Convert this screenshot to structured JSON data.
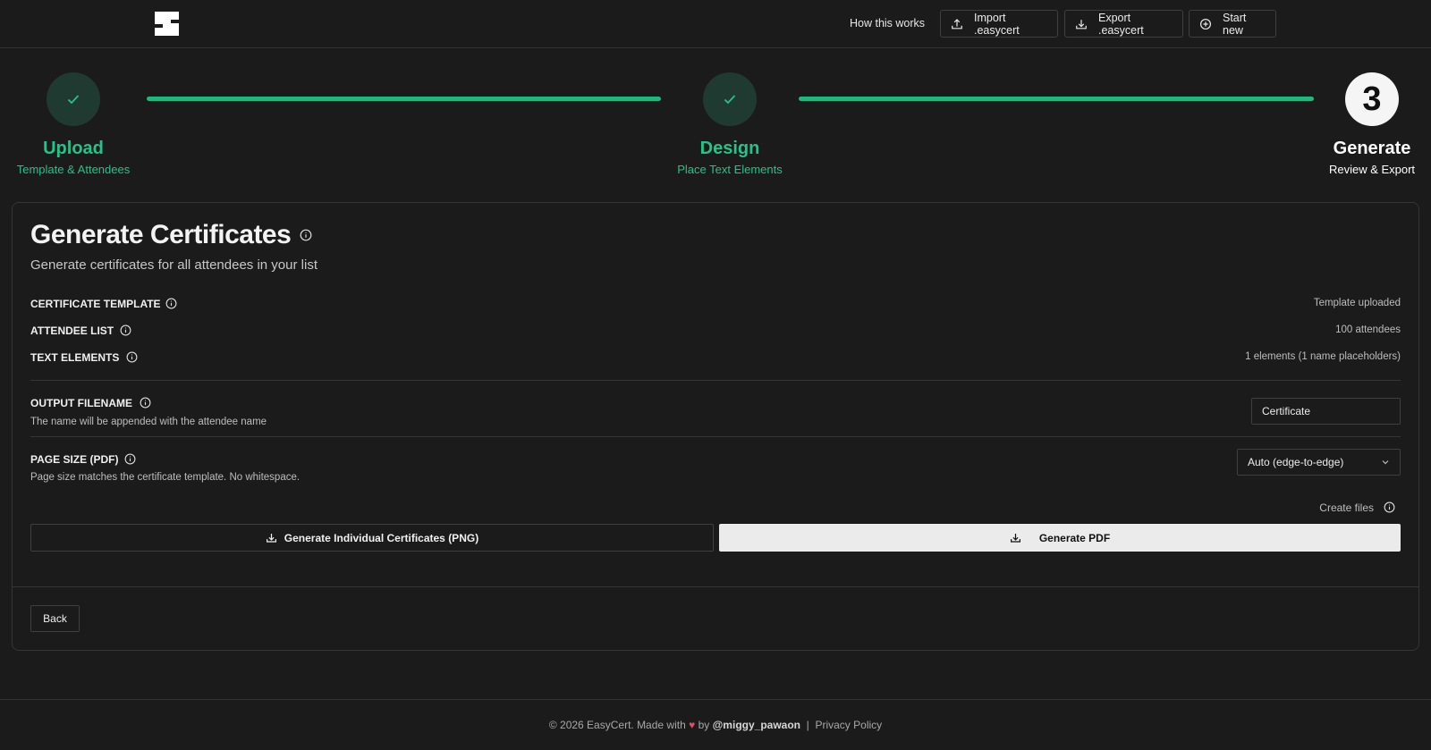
{
  "header": {
    "how_it_works": "How this works",
    "import_label": "Import .easycert",
    "export_label": "Export .easycert",
    "start_new_label": "Start new"
  },
  "stepper": {
    "steps": [
      {
        "title": "Upload",
        "subtitle": "Template & Attendees",
        "state": "done"
      },
      {
        "title": "Design",
        "subtitle": "Place Text Elements",
        "state": "done"
      },
      {
        "title": "Generate",
        "subtitle": "Review & Export",
        "state": "active",
        "number": "3"
      }
    ],
    "accent": "#22c48a"
  },
  "main": {
    "title": "Generate Certificates",
    "subtitle": "Generate certificates for all attendees in your list",
    "rows": {
      "template_label": "CERTIFICATE TEMPLATE",
      "template_value": "Template uploaded",
      "attendee_label": "ATTENDEE LIST",
      "attendee_value": "100 attendees",
      "elements_label": "TEXT ELEMENTS",
      "elements_value": "1 elements (1 name placeholders)"
    },
    "output": {
      "label": "OUTPUT FILENAME",
      "hint": "The name will be appended with the attendee name",
      "value": "Certificate"
    },
    "page_size": {
      "label": "PAGE SIZE (PDF)",
      "hint": "Page size matches the certificate template. No whitespace.",
      "selected": "Auto (edge-to-edge)"
    },
    "create_files": "Create files",
    "png_button": "Generate Individual Certificates (PNG)",
    "pdf_button": "Generate PDF",
    "back_button": "Back"
  },
  "footer": {
    "copyright": "© 2026 EasyCert. Made with",
    "by": "by",
    "handle": "@miggy_pawaon",
    "separator": "|",
    "privacy": "Privacy Policy"
  }
}
